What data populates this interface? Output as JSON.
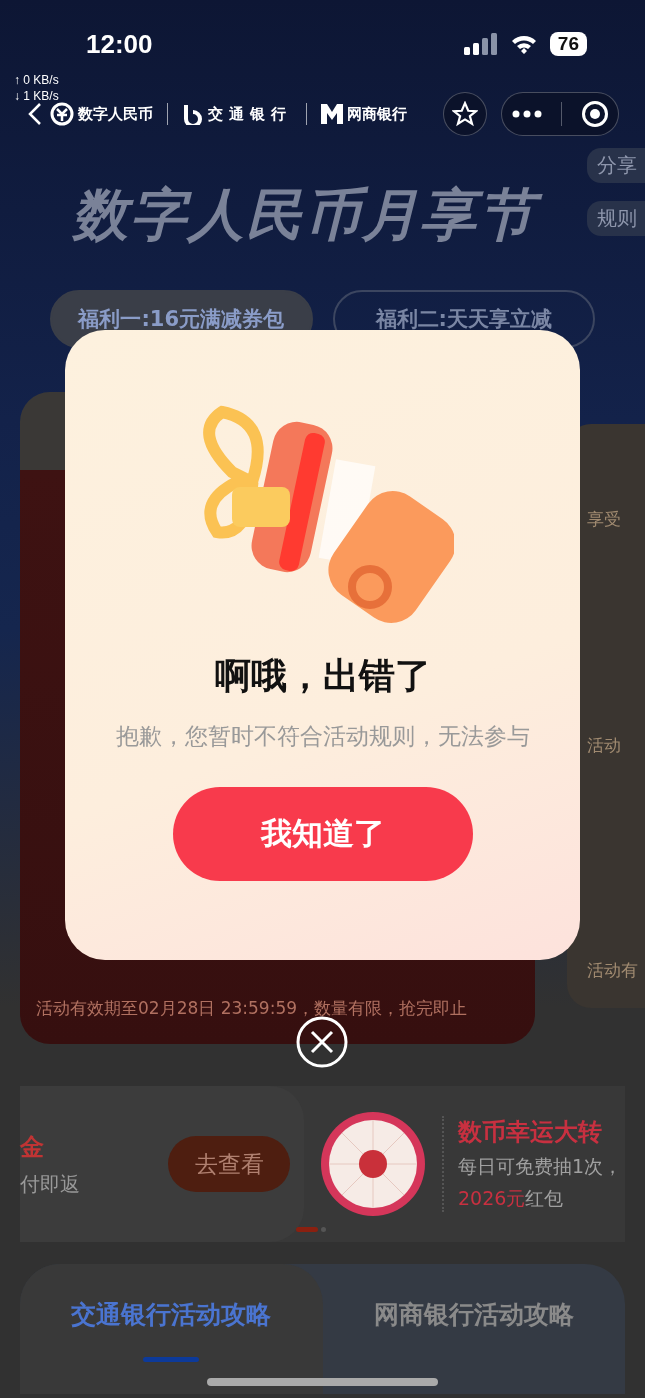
{
  "status_bar": {
    "time": "12:00",
    "battery": "76"
  },
  "net_speed": [
    "↑ 0 KB/s",
    "↓ 1 KB/s"
  ],
  "nav": {
    "brands": [
      "数字人民币",
      "交通银行",
      "网商银行"
    ]
  },
  "hero": {
    "title": "数字人民币月享节",
    "side_buttons": [
      "分享",
      "规则"
    ]
  },
  "benefit_tabs": [
    {
      "label": "福利一:16元满减券包",
      "selected": true
    },
    {
      "label": "福利二:天天享立减",
      "selected": false
    }
  ],
  "main_card": {
    "footer": "活动有效期至02月28日 23:59:59，数量有限，抢完即止"
  },
  "side_card": {
    "texts": [
      "享受",
      "活动",
      "活动有"
    ]
  },
  "carousel": {
    "cards": [
      {
        "kind": "promo",
        "title": "金",
        "subtitle": "付即返",
        "button": "去查看"
      },
      {
        "kind": "wheel",
        "title": "数币幸运大转",
        "line": "每日可免费抽1次，",
        "highlight": "2026元",
        "rest": "红包"
      }
    ],
    "dots": [
      {
        "selected": true
      },
      {
        "selected": false
      }
    ]
  },
  "guide_tabs": [
    {
      "label": "交通银行活动攻略",
      "selected": true
    },
    {
      "label": "网商银行活动攻略",
      "selected": false
    }
  ],
  "dialog": {
    "title": "啊哦，出错了",
    "message": "抱歉，您暂时不符合活动规则，无法参与",
    "button": "我知道了"
  }
}
